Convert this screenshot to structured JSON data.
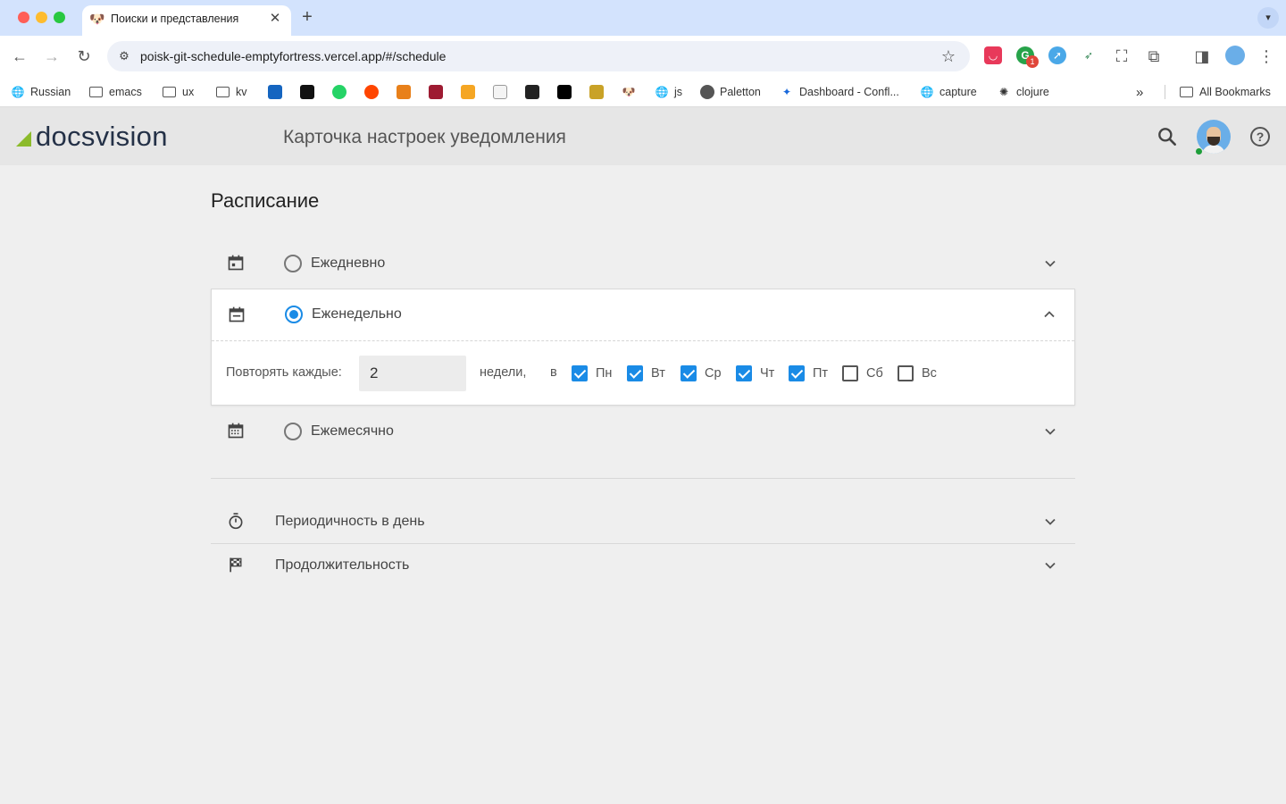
{
  "browser": {
    "tab_title": "Поиски и представления",
    "tab_favicon": "dog-favicon",
    "url": "poisk-git-schedule-emptyfortress.vercel.app/#/schedule",
    "extension_badge": "1",
    "bookmarks": [
      {
        "label": "Russian",
        "icon": "globe-icon"
      },
      {
        "label": "emacs",
        "icon": "folder-icon"
      },
      {
        "label": "ux",
        "icon": "folder-icon"
      },
      {
        "label": "kv",
        "icon": "folder-icon"
      },
      {
        "label": "js",
        "icon": "globe-icon"
      },
      {
        "label": "Paletton",
        "icon": "paletton-icon"
      },
      {
        "label": "Dashboard - Confl...",
        "icon": "confluence-icon"
      },
      {
        "label": "capture",
        "icon": "globe-icon"
      },
      {
        "label": "clojure",
        "icon": "clojure-icon"
      }
    ],
    "all_bookmarks": "All Bookmarks",
    "colors": {
      "tabstrip": "#d3e3fd",
      "toolbar": "#ffffff"
    }
  },
  "app": {
    "logo": "docsvision",
    "title": "Карточка настроек уведомления",
    "colors": {
      "header": "#e6e6e6",
      "accent": "#1a8be6",
      "logo_mark": "#8cbb2b",
      "presence": "#1e9e3a"
    }
  },
  "schedule": {
    "title": "Расписание",
    "options": [
      {
        "label": "Ежедневно",
        "selected": false,
        "expanded": false,
        "icon": "calendar-icon"
      },
      {
        "label": "Еженедельно",
        "selected": true,
        "expanded": true,
        "icon": "calendar-week-icon"
      },
      {
        "label": "Ежемесячно",
        "selected": false,
        "expanded": false,
        "icon": "calendar-month-icon"
      }
    ],
    "weekly": {
      "repeat_label": "Повторять каждые:",
      "repeat_value": "2",
      "weeks_label": "недели,",
      "in_label": "в",
      "days": [
        {
          "label": "Пн",
          "checked": true
        },
        {
          "label": "Вт",
          "checked": true
        },
        {
          "label": "Ср",
          "checked": true
        },
        {
          "label": "Чт",
          "checked": true
        },
        {
          "label": "Пт",
          "checked": true
        },
        {
          "label": "Сб",
          "checked": false
        },
        {
          "label": "Вс",
          "checked": false
        }
      ]
    },
    "sections": [
      {
        "label": "Периодичность в день",
        "icon": "timer-icon"
      },
      {
        "label": "Продолжительность",
        "icon": "checkered-flag-icon"
      }
    ]
  }
}
